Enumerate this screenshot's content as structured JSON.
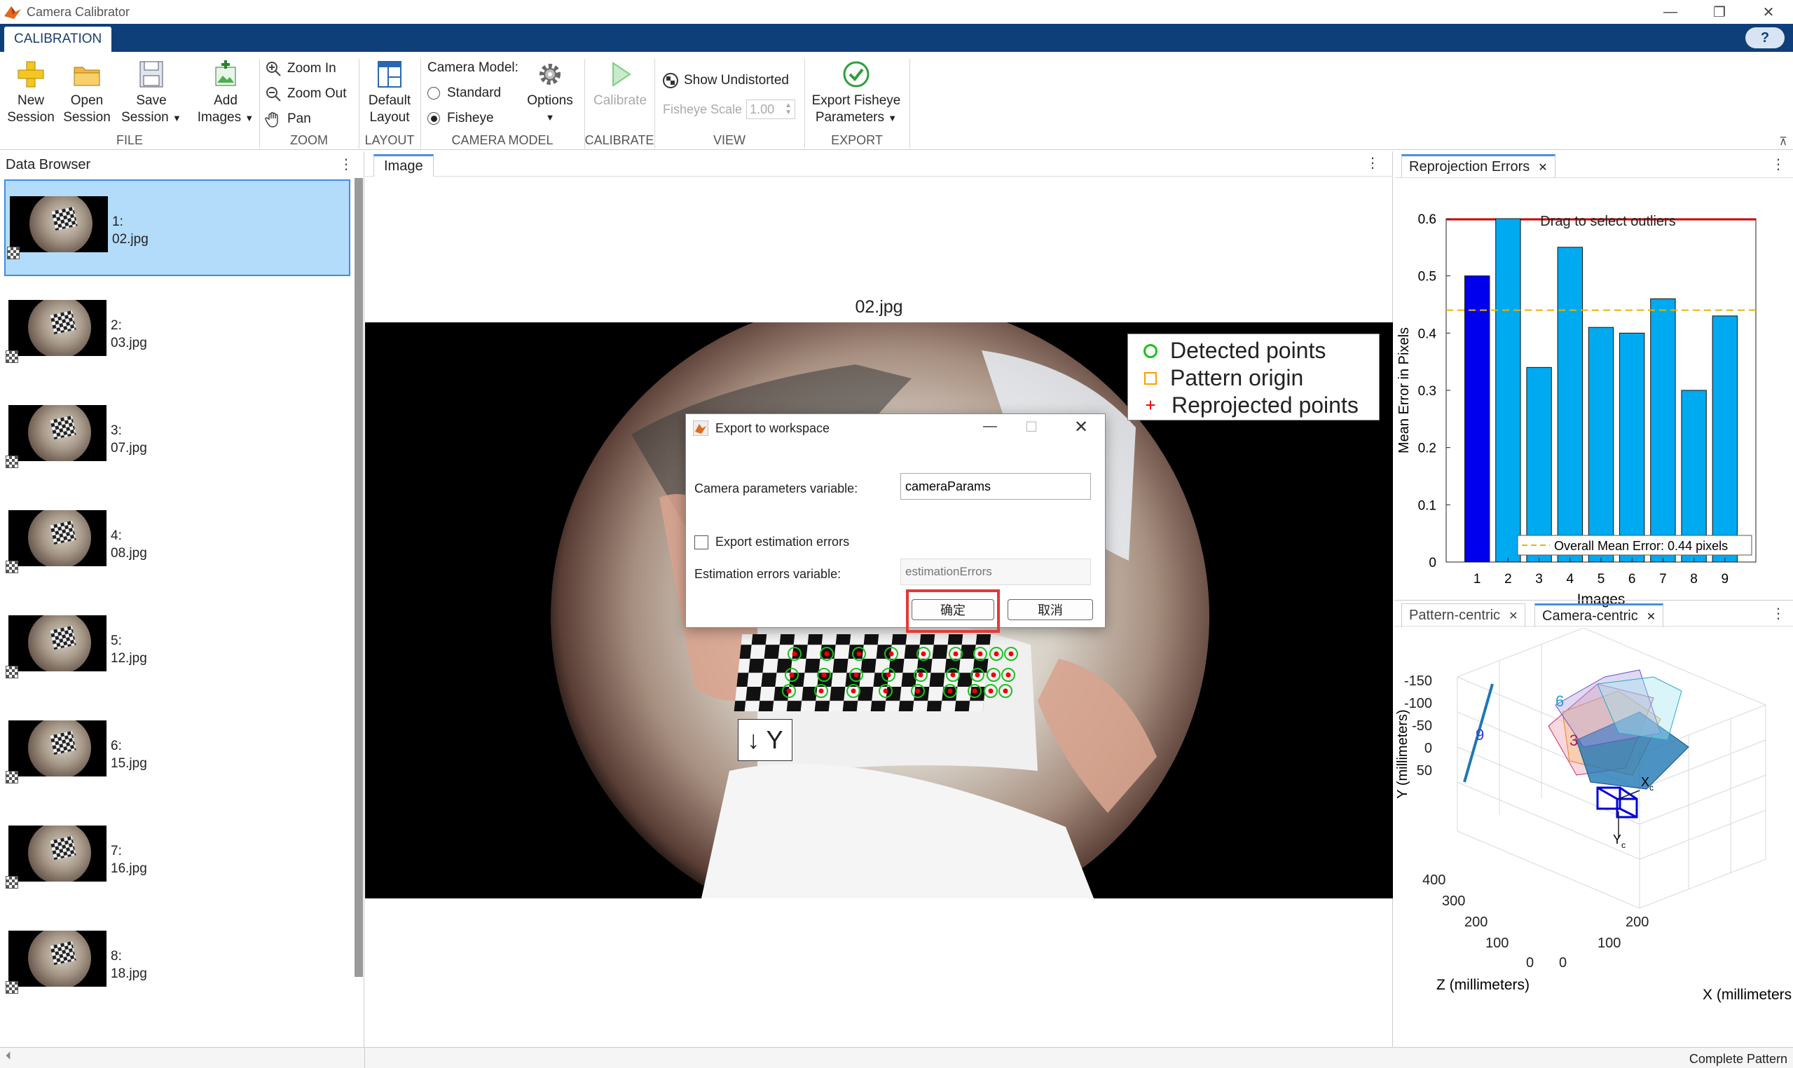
{
  "window": {
    "title": "Camera Calibrator"
  },
  "ribbon": {
    "tab": "CALIBRATION",
    "help": "?"
  },
  "file": {
    "section": "FILE",
    "new_session": [
      "New",
      "Session"
    ],
    "open_session": [
      "Open",
      "Session"
    ],
    "save_session": [
      "Save",
      "Session"
    ],
    "add_images": [
      "Add",
      "Images"
    ]
  },
  "zoom": {
    "section": "ZOOM",
    "zoom_in": "Zoom In",
    "zoom_out": "Zoom Out",
    "pan": "Pan"
  },
  "layout": {
    "section": "LAYOUT",
    "default_layout": [
      "Default",
      "Layout"
    ]
  },
  "camera_model": {
    "section": "CAMERA MODEL",
    "label": "Camera Model:",
    "standard": "Standard",
    "fisheye": "Fisheye",
    "selected": "Fisheye",
    "options": "Options"
  },
  "calibrate": {
    "section": "CALIBRATE",
    "calibrate_btn": "Calibrate"
  },
  "view": {
    "section": "VIEW",
    "show_undistorted": "Show Undistorted",
    "fisheye_scale_label": "Fisheye Scale",
    "fisheye_scale_value": "1.00"
  },
  "export": {
    "section": "EXPORT",
    "export_btn": [
      "Export Fisheye",
      "Parameters"
    ]
  },
  "data_browser": {
    "title": "Data Browser",
    "items": [
      {
        "index": "1:",
        "file": "02.jpg",
        "selected": true
      },
      {
        "index": "2:",
        "file": "03.jpg"
      },
      {
        "index": "3:",
        "file": "07.jpg"
      },
      {
        "index": "4:",
        "file": "08.jpg"
      },
      {
        "index": "5:",
        "file": "12.jpg"
      },
      {
        "index": "6:",
        "file": "15.jpg"
      },
      {
        "index": "7:",
        "file": "16.jpg"
      },
      {
        "index": "8:",
        "file": "18.jpg"
      }
    ]
  },
  "image_panel": {
    "tab": "Image",
    "image_title": "02.jpg",
    "legend": [
      "Detected points",
      "Pattern origin",
      "Reprojected points"
    ],
    "y_axis_marker": "↓ Y"
  },
  "dialog": {
    "title": "Export to workspace",
    "camera_params_label": "Camera parameters variable:",
    "camera_params_value": "cameraParams",
    "export_errors_label": "Export estimation errors",
    "export_errors_checked": false,
    "errors_var_label": "Estimation errors variable:",
    "errors_var_placeholder": "estimationErrors",
    "ok": "确定",
    "cancel": "取消"
  },
  "reprojection": {
    "tab": "Reprojection Errors",
    "drag_text": "Drag to select outliers",
    "ylabel": "Mean Error in Pixels",
    "xlabel": "Images",
    "legend": "Overall Mean Error: 0.44 pixels",
    "ytick_labels": [
      "0",
      "0.1",
      "0.2",
      "0.3",
      "0.4",
      "0.5",
      "0.6"
    ],
    "xtick_labels": [
      "1",
      "2",
      "3",
      "4",
      "5",
      "6",
      "7",
      "8",
      "9"
    ]
  },
  "chart_data": {
    "type": "bar",
    "categories": [
      "1",
      "2",
      "3",
      "4",
      "5",
      "6",
      "7",
      "8",
      "9"
    ],
    "values": [
      0.5,
      0.6,
      0.34,
      0.55,
      0.41,
      0.4,
      0.46,
      0.3,
      0.43
    ],
    "highlighted_index": 0,
    "overall_mean": 0.44,
    "ylim": [
      0,
      0.6
    ],
    "title": "",
    "xlabel": "Images",
    "ylabel": "Mean Error in Pixels",
    "legend": "Overall Mean Error: 0.44 pixels",
    "annotation": "Drag to select outliers",
    "colors": {
      "bar": "#00aaf0",
      "selected": "#0000ee",
      "mean_line": "#e6b500",
      "threshold": "#cc0000"
    }
  },
  "extrinsics": {
    "tabs": [
      "Pattern-centric",
      "Camera-centric"
    ],
    "active_tab": "Camera-centric",
    "ylabel": "Y (millimeters)",
    "zlabel": "Z (millimeters)",
    "xlabel": "X (millimeters",
    "y_ticks": [
      "-150",
      "-100",
      "-50",
      "0",
      "50"
    ],
    "z_ticks": [
      "400",
      "300",
      "200",
      "100",
      "0"
    ],
    "x_ticks": [
      "0",
      "100",
      "200"
    ],
    "axis_x": "X",
    "axis_y": "Y",
    "axis_sub": "c",
    "board_labels": [
      "9",
      "6",
      "3"
    ]
  },
  "status": {
    "text": "Complete Pattern"
  },
  "colors": {
    "ribbon": "#0f3f79",
    "selection": "#b3dcfb",
    "highlight_box": "#e53935"
  }
}
